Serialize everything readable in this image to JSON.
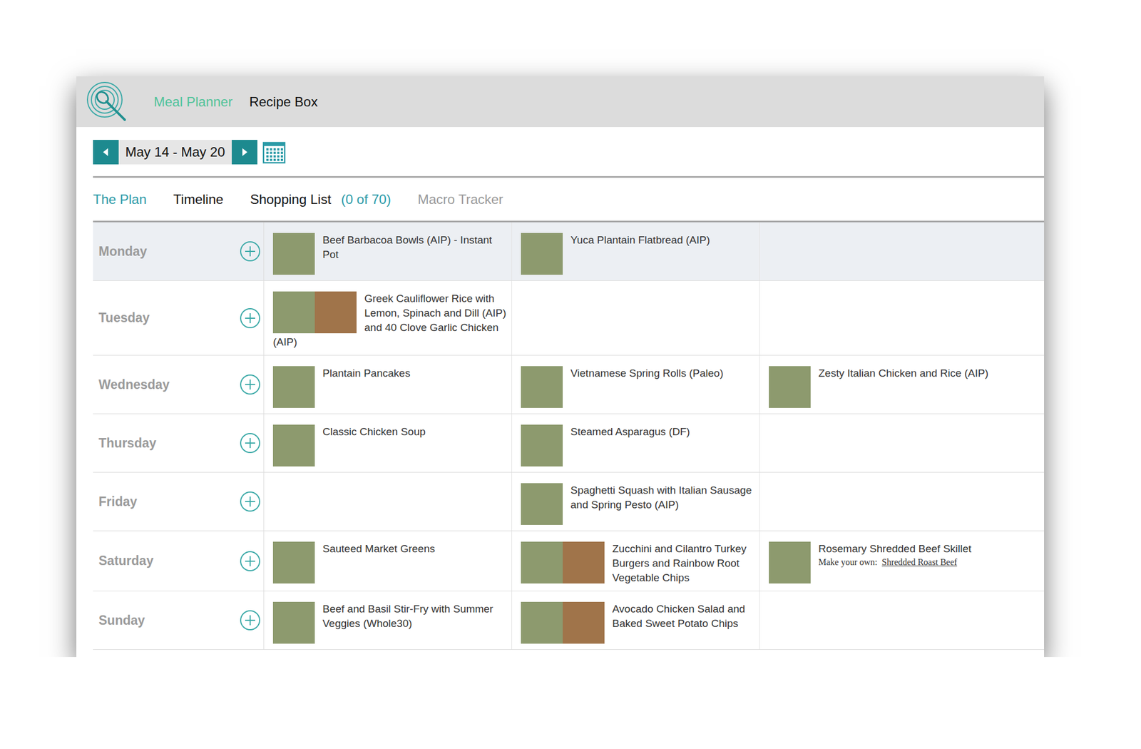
{
  "app": {
    "nav": [
      {
        "label": "Meal Planner",
        "selected": true
      },
      {
        "label": "Recipe Box",
        "selected": false
      }
    ]
  },
  "week": {
    "range": "May 14 - May 20"
  },
  "tabs": [
    {
      "label": "The Plan",
      "selected": true,
      "disabled": false
    },
    {
      "label": "Timeline",
      "selected": false,
      "disabled": false
    },
    {
      "label": "Shopping List",
      "count": "(0 of 70)",
      "selected": false,
      "disabled": false
    },
    {
      "label": "Macro Tracker",
      "selected": false,
      "disabled": true
    }
  ],
  "days": [
    {
      "name": "Monday",
      "selected": true,
      "slots": [
        {
          "title": "Beef Barbacoa Bowls (AIP) - Instant Pot",
          "photos": 1
        },
        {
          "title": "Yuca Plantain Flatbread (AIP)",
          "photos": 1
        },
        null
      ]
    },
    {
      "name": "Tuesday",
      "selected": false,
      "slots": [
        {
          "title": "Greek Cauliflower Rice with Lemon, Spinach and Dill (AIP) and 40 Clove Garlic Chicken (AIP)",
          "photos": 2
        },
        null,
        null
      ]
    },
    {
      "name": "Wednesday",
      "selected": false,
      "slots": [
        {
          "title": "Plantain Pancakes",
          "photos": 1
        },
        {
          "title": "Vietnamese Spring Rolls (Paleo)",
          "photos": 1
        },
        {
          "title": "Zesty Italian Chicken and Rice (AIP)",
          "photos": 1
        }
      ]
    },
    {
      "name": "Thursday",
      "selected": false,
      "slots": [
        {
          "title": "Classic Chicken Soup",
          "photos": 1
        },
        {
          "title": "Steamed Asparagus (DF)",
          "photos": 1
        },
        null
      ]
    },
    {
      "name": "Friday",
      "selected": false,
      "slots": [
        null,
        {
          "title": "Spaghetti Squash with Italian Sausage and Spring Pesto (AIP)",
          "photos": 1
        },
        null
      ]
    },
    {
      "name": "Saturday",
      "selected": false,
      "slots": [
        {
          "title": "Sauteed Market Greens",
          "photos": 1
        },
        {
          "title": "Zucchini and Cilantro Turkey Burgers and Rainbow Root Vegetable Chips",
          "photos": 2
        },
        {
          "title": "Rosemary Shredded Beef Skillet",
          "photos": 1,
          "note": "Make your own:",
          "link": "Shredded Roast Beef"
        }
      ]
    },
    {
      "name": "Sunday",
      "selected": false,
      "slots": [
        {
          "title": "Beef and Basil Stir-Fry with Summer Veggies (Whole30)",
          "photos": 1
        },
        {
          "title": "Avocado Chicken Salad and Baked Sweet Potato Chips",
          "photos": 2
        },
        null
      ]
    }
  ]
}
